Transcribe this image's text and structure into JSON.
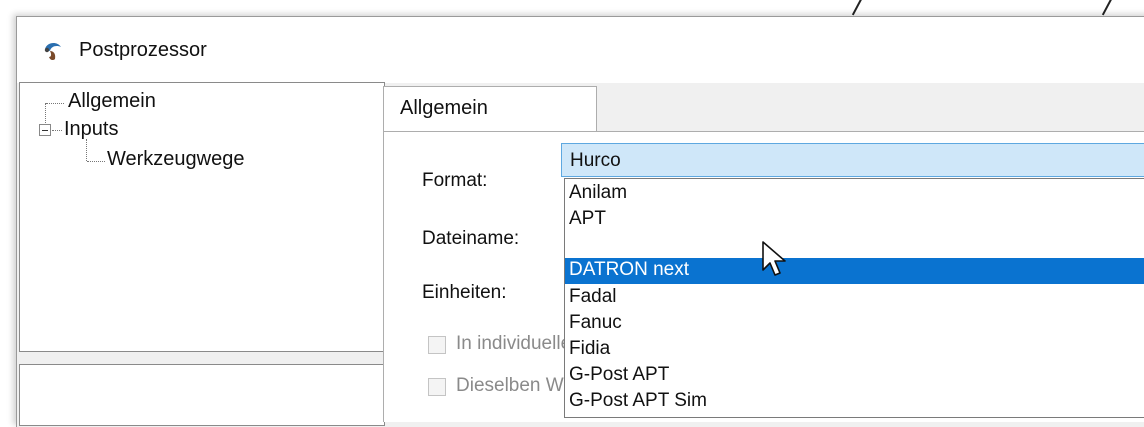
{
  "window": {
    "title": "Postprozessor",
    "icon": "app-swirl-icon"
  },
  "tree": {
    "items": [
      {
        "label": "Allgemein"
      },
      {
        "label": "Inputs"
      },
      {
        "label": "Werkzeugwege"
      }
    ]
  },
  "tab": {
    "label": "Allgemein"
  },
  "form": {
    "format_label": "Format:",
    "filename_label": "Dateiname:",
    "units_label": "Einheiten:",
    "checkbox1_label": "In individuelle",
    "checkbox2_label": "Dieselben We"
  },
  "format_select": {
    "value": "Hurco",
    "options": [
      "Anilam",
      "APT",
      "DATRON next",
      "Fadal",
      "Fanuc",
      "Fidia",
      "G-Post APT",
      "G-Post APT Sim"
    ],
    "highlighted": "DATRON next"
  },
  "colors": {
    "highlight": "#0a73d0",
    "select_bg": "#cfe7f9"
  }
}
